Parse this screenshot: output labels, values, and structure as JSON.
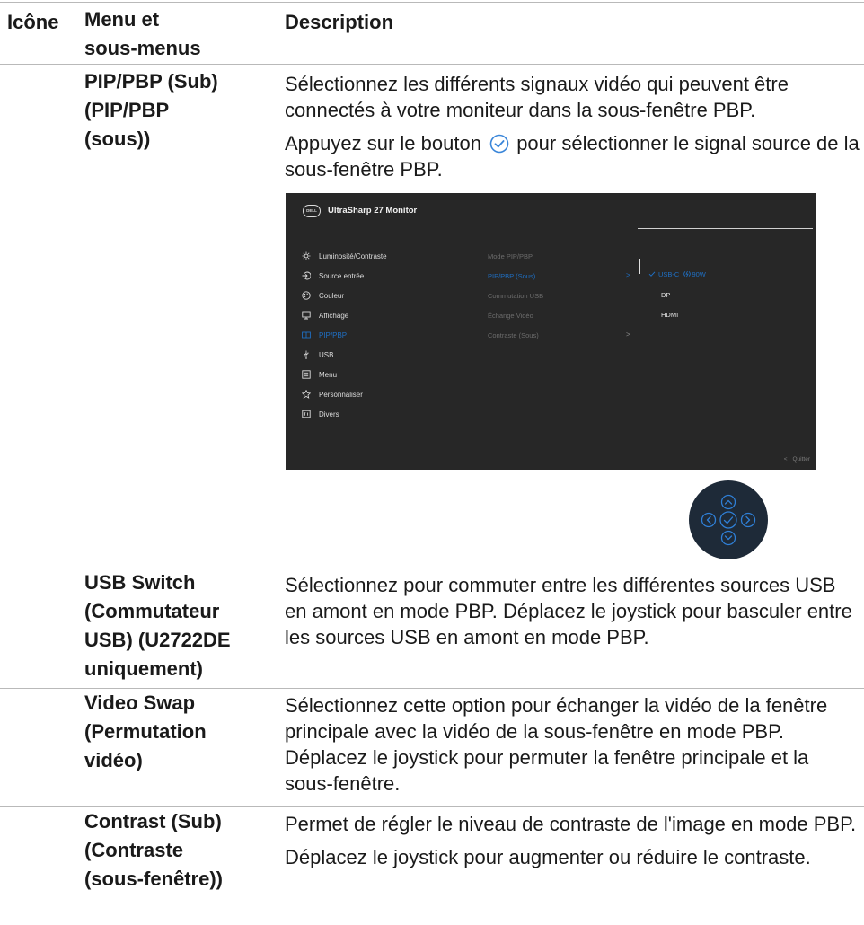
{
  "header": {
    "col_icon": "Icône",
    "col_menu": "Menu et\nsous-menus",
    "col_desc": "Description"
  },
  "rows": [
    {
      "name": "PIP/PBP (Sub)\n(PIP/PBP\n(sous))",
      "desc1": "Sélectionnez les différents signaux vidéo qui peuvent être connectés à votre moniteur dans la sous-fenêtre PBP.",
      "desc2_pre": "Appuyez sur le bouton",
      "desc2_post": "pour sélectionner le signal source de la sous-fenêtre PBP."
    },
    {
      "name": "USB Switch\n(Commutateur\nUSB) (U2722DE\nuniquement)",
      "desc": "Sélectionnez pour commuter entre les différentes sources USB en amont en mode PBP. Déplacez le joystick pour basculer entre les sources USB en amont en mode PBP."
    },
    {
      "name": "Video Swap\n(Permutation\nvidéo)",
      "desc": "Sélectionnez cette option pour échanger la vidéo de la fenêtre principale avec la vidéo de la sous-fenêtre en mode PBP. Déplacez le joystick pour permuter la fenêtre principale et la sous-fenêtre."
    },
    {
      "name": "Contrast (Sub)\n(Contraste\n(sous-fenêtre))",
      "desc1": "Permet de régler le niveau de contraste de l'image en mode PBP.",
      "desc2": "Déplacez le joystick pour augmenter ou réduire le contraste."
    }
  ],
  "osd": {
    "logo": "DELL",
    "title": "UltraSharp 27 Monitor",
    "menu": [
      {
        "label": "Luminosité/Contraste",
        "icon": "sun-icon"
      },
      {
        "label": "Source entrée",
        "icon": "input-icon"
      },
      {
        "label": "Couleur",
        "icon": "palette-icon"
      },
      {
        "label": "Affichage",
        "icon": "monitor-icon"
      },
      {
        "label": "PIP/PBP",
        "icon": "pip-icon"
      },
      {
        "label": "USB",
        "icon": "usb-icon"
      },
      {
        "label": "Menu",
        "icon": "menu-icon"
      },
      {
        "label": "Personnaliser",
        "icon": "star-icon"
      },
      {
        "label": "Divers",
        "icon": "info-icon"
      }
    ],
    "submenu": [
      "Mode PIP/PBP",
      "PIP/PBP (Sous)",
      "Commutation USB",
      "Échange Vidéo",
      "Contraste (Sous)"
    ],
    "options": [
      {
        "label": "USB-C",
        "suffix": "90W"
      },
      {
        "label": "DP"
      },
      {
        "label": "HDMI"
      }
    ],
    "quit": "Quitter",
    "accent": "#1f6fc3",
    "background": "#272727"
  },
  "joystick": {
    "color": "#1e2a38",
    "accent": "#2f7fd6"
  }
}
